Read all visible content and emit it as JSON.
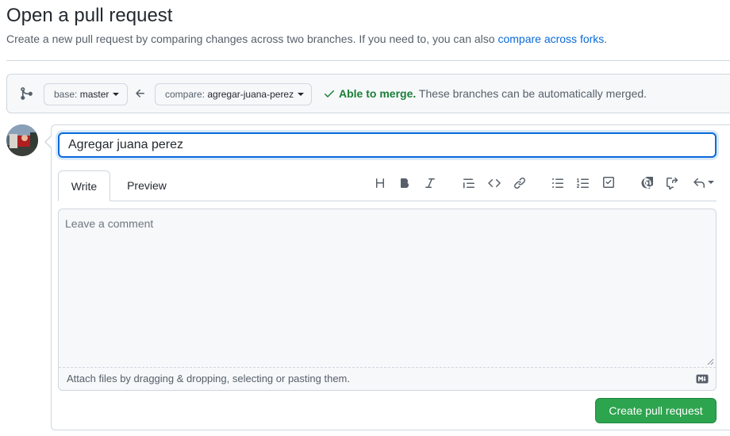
{
  "header": {
    "title": "Open a pull request",
    "subtitle": "Create a new pull request by comparing changes across two branches. If you need to, you can also ",
    "subtitle_link": "compare across forks",
    "subtitle_end": "."
  },
  "range": {
    "base_prefix": "base:",
    "base_branch": "master",
    "compare_prefix": "compare:",
    "compare_branch": "agregar-juana-perez",
    "merge_ok": "Able to merge.",
    "merge_detail": " These branches can be automatically merged."
  },
  "form": {
    "title_value": "Agregar juana perez",
    "tabs": [
      "Write",
      "Preview"
    ],
    "comment_placeholder": "Leave a comment",
    "comment_value": "",
    "attach_text": "Attach files by dragging & dropping, selecting or pasting them.",
    "submit_label": "Create pull request"
  },
  "toolbar_icons": [
    "heading-icon",
    "bold-icon",
    "italic-icon",
    "quote-icon",
    "code-icon",
    "link-icon",
    "unordered-list-icon",
    "ordered-list-icon",
    "task-list-icon",
    "mention-icon",
    "cross-reference-icon",
    "saved-replies-icon"
  ],
  "colors": {
    "link": "#0969da",
    "success": "#1a7f37",
    "primary_button": "#2da44e",
    "border": "#d0d7de"
  }
}
